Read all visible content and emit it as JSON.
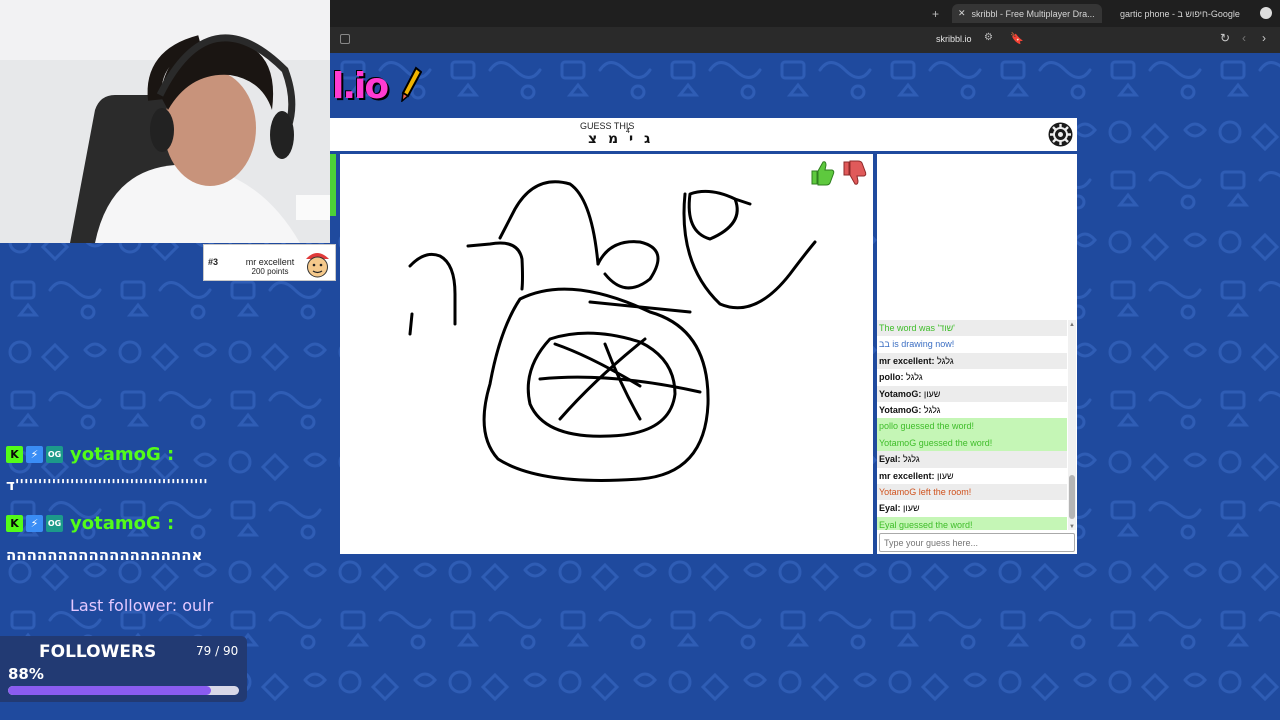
{
  "browser": {
    "tabs": [
      {
        "label": "skribbl - Free Multiplayer Dra...",
        "active": true
      },
      {
        "label": "gartic phone - חיפוש ב-Google",
        "active": false
      }
    ],
    "new_tab_icon": "plus-icon",
    "address": "skribbl.io"
  },
  "game": {
    "logo_part1": "l.io",
    "guess_label": "GUESS THIS",
    "guess_word": "ג י מ צ",
    "guess_letter_count": "4",
    "like_icon": "thumbs-up-icon",
    "dislike_icon": "thumbs-down-icon",
    "settings_icon": "gear-icon"
  },
  "player": {
    "rank": "#3",
    "name": "mr excellent",
    "points": "200 points"
  },
  "chat": {
    "messages": [
      {
        "text": "The word was 'שוד'",
        "style": "greentext alt"
      },
      {
        "text": "בב is drawing now!",
        "style": "blue"
      },
      {
        "name": "mr excellent:",
        "text": "גלגל",
        "style": "alt"
      },
      {
        "name": "pollo:",
        "text": "גלגל",
        "style": ""
      },
      {
        "name": "YotamoG:",
        "text": "שעון",
        "style": "alt"
      },
      {
        "name": "YotamoG:",
        "text": "גלגל",
        "style": ""
      },
      {
        "text": "pollo guessed the word!",
        "style": "green"
      },
      {
        "text": "YotamoG guessed the word!",
        "style": "green"
      },
      {
        "name": "Eyal:",
        "text": "גלגל",
        "style": "alt"
      },
      {
        "name": "mr excellent:",
        "text": "שעון",
        "style": ""
      },
      {
        "text": "YotamoG left the room!",
        "style": "red alt"
      },
      {
        "name": "Eyal:",
        "text": "שעון",
        "style": ""
      },
      {
        "text": "Eyal guessed the word!",
        "style": "green"
      }
    ],
    "input_placeholder": "Type your guess here..."
  },
  "stream": {
    "chat": [
      {
        "user": "yotamoG :",
        "text": "ד''''''''''''''''''''''''''''''''''''''''''"
      },
      {
        "user": "yotamoG :",
        "text": "אהההההההההההההההההה"
      }
    ],
    "last_follower": "Last follower: oulr",
    "followers_title": "FOLLOWERS",
    "followers_count": "79 / 90",
    "followers_percent_label": "88%",
    "followers_fraction": 0.88
  }
}
